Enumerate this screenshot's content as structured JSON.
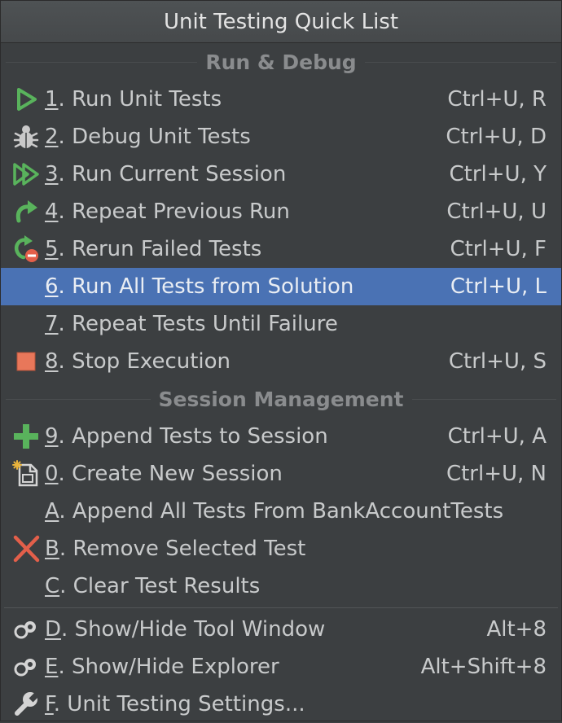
{
  "title": "Unit Testing Quick List",
  "sections": {
    "run_debug": "Run & Debug",
    "session_management": "Session Management"
  },
  "items": {
    "run_unit_tests": {
      "mnemonic": "1",
      "label": ". Run Unit Tests",
      "shortcut": "Ctrl+U, R",
      "icon": "run-play-icon"
    },
    "debug_unit_tests": {
      "mnemonic": "2",
      "label": ". Debug Unit Tests",
      "shortcut": "Ctrl+U, D",
      "icon": "debug-bug-icon"
    },
    "run_current_session": {
      "mnemonic": "3",
      "label": ". Run Current Session",
      "shortcut": "Ctrl+U, Y",
      "icon": "run-session-icon"
    },
    "repeat_previous_run": {
      "mnemonic": "4",
      "label": ". Repeat Previous Run",
      "shortcut": "Ctrl+U, U",
      "icon": "repeat-arrow-icon"
    },
    "rerun_failed_tests": {
      "mnemonic": "5",
      "label": ". Rerun Failed Tests",
      "shortcut": "Ctrl+U, F",
      "icon": "rerun-failed-icon"
    },
    "run_all_tests": {
      "mnemonic": "6",
      "label": ". Run All Tests from Solution",
      "shortcut": "Ctrl+U, L",
      "icon": ""
    },
    "repeat_until_failure": {
      "mnemonic": "7",
      "label": ". Repeat Tests Until Failure",
      "shortcut": "",
      "icon": ""
    },
    "stop_execution": {
      "mnemonic": "8",
      "label": ". Stop Execution",
      "shortcut": "Ctrl+U, S",
      "icon": "stop-square-icon"
    },
    "append_to_session": {
      "mnemonic": "9",
      "label": ". Append Tests to Session",
      "shortcut": "Ctrl+U, A",
      "icon": "plus-icon"
    },
    "create_new_session": {
      "mnemonic": "0",
      "label": ". Create New Session",
      "shortcut": "Ctrl+U, N",
      "icon": "new-session-icon"
    },
    "append_all_tests": {
      "mnemonic": "A",
      "label": ". Append All Tests From BankAccountTests",
      "shortcut": "",
      "icon": ""
    },
    "remove_selected": {
      "mnemonic": "B",
      "label": ". Remove Selected Test",
      "shortcut": "",
      "icon": "remove-x-icon"
    },
    "clear_results": {
      "mnemonic": "C",
      "label": ". Clear Test Results",
      "shortcut": "",
      "icon": ""
    },
    "toggle_tool_window": {
      "mnemonic": "D",
      "label": ". Show/Hide Tool Window",
      "shortcut": "Alt+8",
      "icon": "tool-window-icon"
    },
    "toggle_explorer": {
      "mnemonic": "E",
      "label": ". Show/Hide Explorer",
      "shortcut": "Alt+Shift+8",
      "icon": "explorer-icon"
    },
    "settings": {
      "mnemonic": "F",
      "label": ". Unit Testing Settings...",
      "shortcut": "",
      "icon": "wrench-icon"
    }
  },
  "selected_item": "run_all_tests",
  "colors": {
    "background": "#3c3f41",
    "selection": "#4a72b4",
    "run_green": "#59b35c",
    "stop_orange": "#e8775a",
    "remove_red": "#e35f4a"
  }
}
